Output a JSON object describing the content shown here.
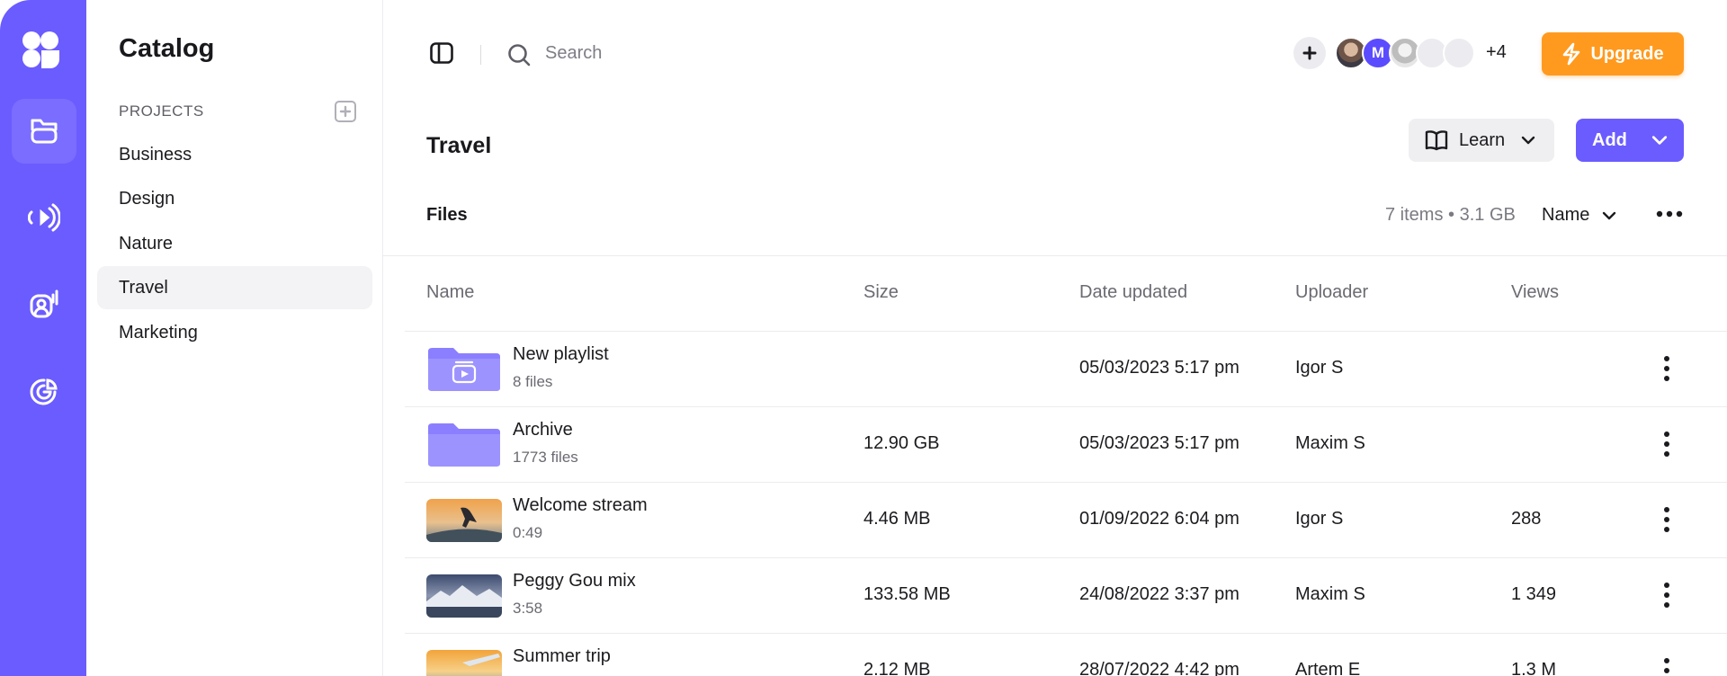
{
  "colors": {
    "brand": "#6b5cff",
    "upgrade": "#ff9a1f",
    "folder": "#8b7fff"
  },
  "rail": {
    "items": [
      "logo-icon",
      "folder-icon",
      "broadcast-icon",
      "voice-user-icon",
      "chart-icon"
    ],
    "active": 1
  },
  "catalog": {
    "title": "Catalog",
    "projects_label": "PROJECTS",
    "items": [
      {
        "label": "Business"
      },
      {
        "label": "Design"
      },
      {
        "label": "Nature"
      },
      {
        "label": "Travel",
        "active": true
      },
      {
        "label": "Marketing"
      }
    ]
  },
  "topbar": {
    "search_placeholder": "Search",
    "avatar_initial": "M",
    "avatar_more": "+4",
    "upgrade_label": "Upgrade"
  },
  "page": {
    "title": "Travel",
    "learn_label": "Learn",
    "add_label": "Add"
  },
  "files": {
    "label": "Files",
    "meta": "7 items • 3.1 GB",
    "sort_label": "Name"
  },
  "table": {
    "columns": [
      "Name",
      "Size",
      "Date updated",
      "Uploader",
      "Views"
    ],
    "rows": [
      {
        "name": "New playlist",
        "sub": "8 files",
        "size": "",
        "date": "05/03/2023 5:17 pm",
        "uploader": "Igor S",
        "views": "",
        "thumb": "playlist-folder"
      },
      {
        "name": "Archive",
        "sub": "1773 files",
        "size": "12.90 GB",
        "date": "05/03/2023 5:17 pm",
        "uploader": "Maxim S",
        "views": "",
        "thumb": "folder"
      },
      {
        "name": "Welcome stream",
        "sub": "0:49",
        "size": "4.46 MB",
        "date": "01/09/2022 6:04 pm",
        "uploader": "Igor S",
        "views": "288",
        "thumb": "sunset-skate"
      },
      {
        "name": "Peggy Gou mix",
        "sub": "3:58",
        "size": "133.58 MB",
        "date": "24/08/2022 3:37 pm",
        "uploader": "Maxim S",
        "views": "1 349",
        "thumb": "mountain-lake"
      },
      {
        "name": "Summer trip",
        "sub": "",
        "size": "2.12 MB",
        "date": "28/07/2022 4:42 pm",
        "uploader": "Artem E",
        "views": "1.3 M",
        "thumb": "plane-sunset"
      }
    ]
  }
}
